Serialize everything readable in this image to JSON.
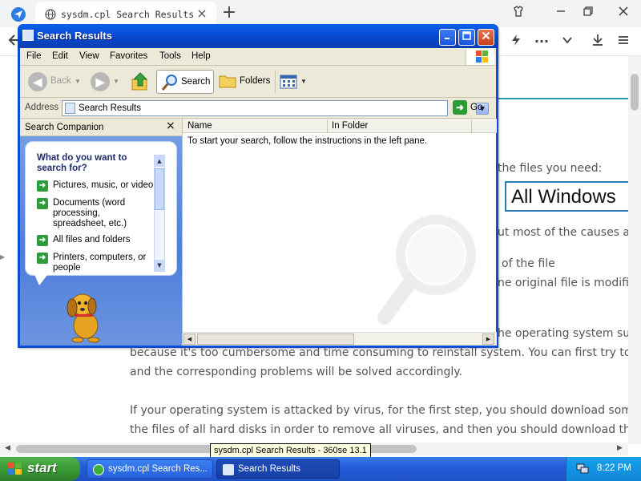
{
  "browser": {
    "tab_title": "sysdm.cpl Search Results",
    "tab_close": "×",
    "new_tab": "+"
  },
  "webpage": {
    "lines": [
      "the files you need:",
      "ut most of the causes are",
      "of the file",
      "ne original file is modified",
      "he operating system succ",
      "because it's too cumbersome and time consuming to reinstall system. You can first try to download",
      "and the corresponding problems will be solved accordingly.",
      "If your operating system is attacked by virus, for the first step, you should download some certain a",
      "the files of all hard disks in order to remove all viruses, and then you should download the normal"
    ],
    "search_box_text": "All Windows"
  },
  "tooltip": "sysdm.cpl Search Results - 360se 13.1",
  "window": {
    "title": "Search Results",
    "menu": [
      "File",
      "Edit",
      "View",
      "Favorites",
      "Tools",
      "Help"
    ],
    "toolbar": {
      "back": "Back",
      "search": "Search",
      "folders": "Folders"
    },
    "address_label": "Address",
    "address_value": "Search Results",
    "go": "Go",
    "companion": {
      "title": "Search Companion",
      "close": "×",
      "question": "What do you want to search for?",
      "options": [
        "Pictures, music, or video",
        "Documents (word processing, spreadsheet, etc.)",
        "All files and folders",
        "Printers, computers, or people"
      ]
    },
    "results": {
      "columns": [
        "Name",
        "In Folder"
      ],
      "instructions": "To start your search, follow the instructions in the left pane."
    }
  },
  "taskbar": {
    "start": "start",
    "tasks": [
      "sysdm.cpl Search Res...",
      "Search Results"
    ],
    "clock": "8:22 PM"
  },
  "colors": {
    "xp_title_blue": "#0846c9",
    "start_green": "#3a9a35",
    "taskbar_blue": "#245ddb",
    "teal_accent": "#2a9bb6"
  }
}
